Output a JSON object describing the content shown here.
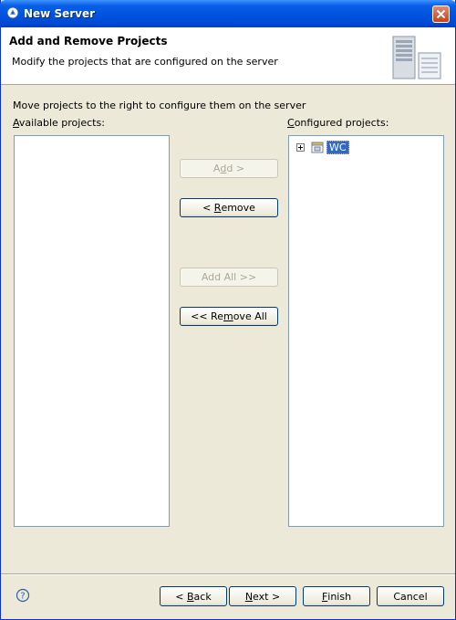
{
  "window": {
    "title": "New Server"
  },
  "header": {
    "title": "Add and Remove Projects",
    "description": "Modify the projects that are configured on the server"
  },
  "instructions": "Move projects to the right to configure them on the server",
  "available": {
    "label_prefix": "",
    "label_mnemonic": "A",
    "label_rest": "vailable projects:",
    "items": []
  },
  "configured": {
    "label_prefix": "",
    "label_mnemonic": "C",
    "label_rest": "onfigured projects:",
    "items": [
      {
        "label": "WC",
        "selected": true
      }
    ]
  },
  "buttons": {
    "add": {
      "pre": "A",
      "mn": "d",
      "post": "d >",
      "enabled": false
    },
    "remove": {
      "pre": "< ",
      "mn": "R",
      "post": "emove",
      "enabled": true
    },
    "add_all": {
      "pre": "Add All >>",
      "mn": "",
      "post": "",
      "enabled": false
    },
    "remove_all": {
      "pre": "<< Re",
      "mn": "m",
      "post": "ove All",
      "enabled": true
    }
  },
  "footer": {
    "back": {
      "pre": "< ",
      "mn": "B",
      "post": "ack"
    },
    "next": {
      "pre": "",
      "mn": "N",
      "post": "ext >"
    },
    "finish": {
      "pre": "",
      "mn": "F",
      "post": "inish"
    },
    "cancel": {
      "pre": "Cancel",
      "mn": "",
      "post": ""
    }
  },
  "icons": {
    "title": "new-server-icon",
    "header_art": "server-tower-icon",
    "help": "help-icon",
    "project": "project-folder-icon"
  },
  "colors": {
    "selection": "#316ac5",
    "titlebar": "#0053e0",
    "dialog_bg": "#ece9d8"
  }
}
